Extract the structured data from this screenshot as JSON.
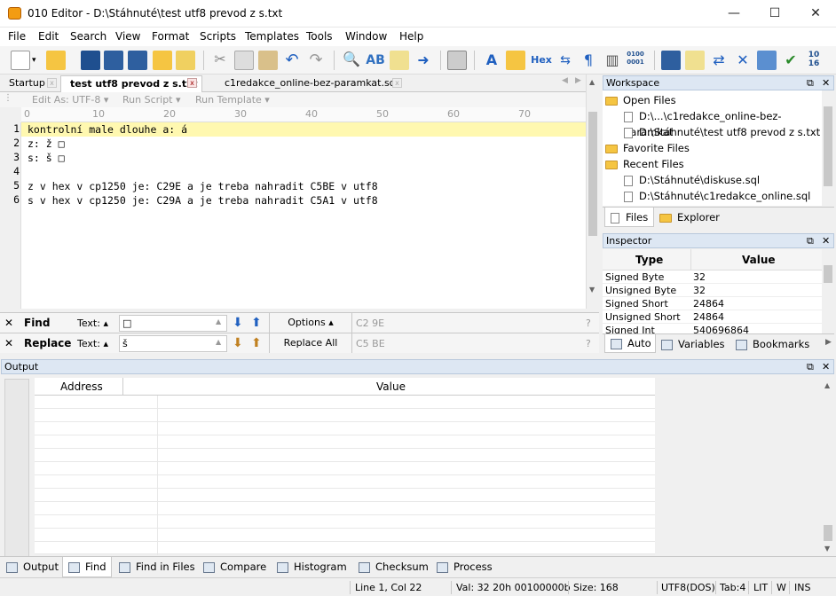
{
  "window": {
    "title": "010 Editor - D:\\Stáhnuté\\test utf8 prevod z s.txt",
    "min": "—",
    "max": "☐",
    "close": "✕"
  },
  "menu": [
    "File",
    "Edit",
    "Search",
    "View",
    "Format",
    "Scripts",
    "Templates",
    "Tools",
    "Window",
    "Help"
  ],
  "tabs": [
    {
      "label": "Startup"
    },
    {
      "label": "test utf8 prevod z s.txt"
    },
    {
      "label": "c1redakce_online-bez-paramkat.sql"
    }
  ],
  "subbar": {
    "edit_as": "Edit As: UTF-8 ▾",
    "run_script": "Run Script ▾",
    "run_template": "Run Template ▾"
  },
  "ruler": [
    "0",
    "10",
    "20",
    "30",
    "40",
    "50",
    "60",
    "70"
  ],
  "editor": {
    "line_numbers": [
      "1",
      "2",
      "3",
      "4",
      "5",
      "6"
    ],
    "lines": [
      "kontrolní male dlouhe a: á",
      "z: ž □",
      "s: š □",
      "",
      "z v hex v cp1250 je: C29E a je treba nahradit C5BE v utf8",
      "s v hex v cp1250 je: C29A a je treba nahradit C5A1 v utf8"
    ]
  },
  "find": {
    "close": "✕",
    "label": "Find",
    "text_label": "Text: ▴",
    "value": "□",
    "options": "Options ▴",
    "hint": "C2 9E",
    "help": "?"
  },
  "replace": {
    "close": "✕",
    "label": "Replace",
    "text_label": "Text: ▴",
    "value": "š",
    "replace_all": "Replace All",
    "hint": "C5 BE",
    "help": "?"
  },
  "workspace": {
    "title": "Workspace",
    "items": [
      {
        "type": "group",
        "label": "Open Files"
      },
      {
        "type": "file",
        "label": "D:\\...\\c1redakce_online-bez-paramkat"
      },
      {
        "type": "file",
        "label": "D:\\Stáhnuté\\test utf8 prevod z s.txt"
      },
      {
        "type": "group",
        "label": "Favorite Files"
      },
      {
        "type": "group",
        "label": "Recent Files"
      },
      {
        "type": "file",
        "label": "D:\\Stáhnuté\\diskuse.sql"
      },
      {
        "type": "file",
        "label": "D:\\Stáhnuté\\c1redakce_online.sql"
      }
    ],
    "tab_files": "Files",
    "tab_explorer": "Explorer"
  },
  "inspector": {
    "title": "Inspector",
    "col_type": "Type",
    "col_value": "Value",
    "rows": [
      {
        "type": "Signed Byte",
        "value": "32"
      },
      {
        "type": "Unsigned Byte",
        "value": "32"
      },
      {
        "type": "Signed Short",
        "value": "24864"
      },
      {
        "type": "Unsigned Short",
        "value": "24864"
      },
      {
        "type": "Signed Int",
        "value": "540696864"
      }
    ],
    "tab_auto": "Auto",
    "tab_variables": "Variables",
    "tab_bookmarks": "Bookmarks"
  },
  "output": {
    "title": "Output",
    "col_address": "Address",
    "col_value": "Value"
  },
  "bottom_tabs": [
    "Output",
    "Find",
    "Find in Files",
    "Compare",
    "Histogram",
    "Checksum",
    "Process"
  ],
  "status": {
    "position": "Line 1, Col 22",
    "val": "Val: 32 20h 00100000b",
    "size": "Size: 168",
    "encoding": "UTF8(DOS)",
    "tab": "Tab:4",
    "lit": "LIT",
    "w": "W",
    "ins": "INS"
  },
  "toolbar_icons": [
    "new-file-icon",
    "dropdown-icon",
    "open-icon",
    "save-icon",
    "save-as-icon",
    "save-all-icon",
    "open-folder-icon",
    "close-icon",
    "cut-icon",
    "copy-icon",
    "paste-icon",
    "undo-icon",
    "redo-icon",
    "find-icon",
    "spellcheck-icon",
    "find-in-files-icon",
    "goto-icon",
    "print-icon",
    "font-icon",
    "highlight-icon",
    "hex-icon",
    "convert-icon",
    "pilcrow-icon",
    "columns-icon",
    "binary-icon",
    "calculator-icon",
    "inspect-icon",
    "compare-icon",
    "tools-icon",
    "histogram-icon",
    "checksum-icon",
    "base-convert-icon"
  ],
  "toolbar_hex_label": "Hex",
  "toolbar_bin_label": "0100\n0001"
}
